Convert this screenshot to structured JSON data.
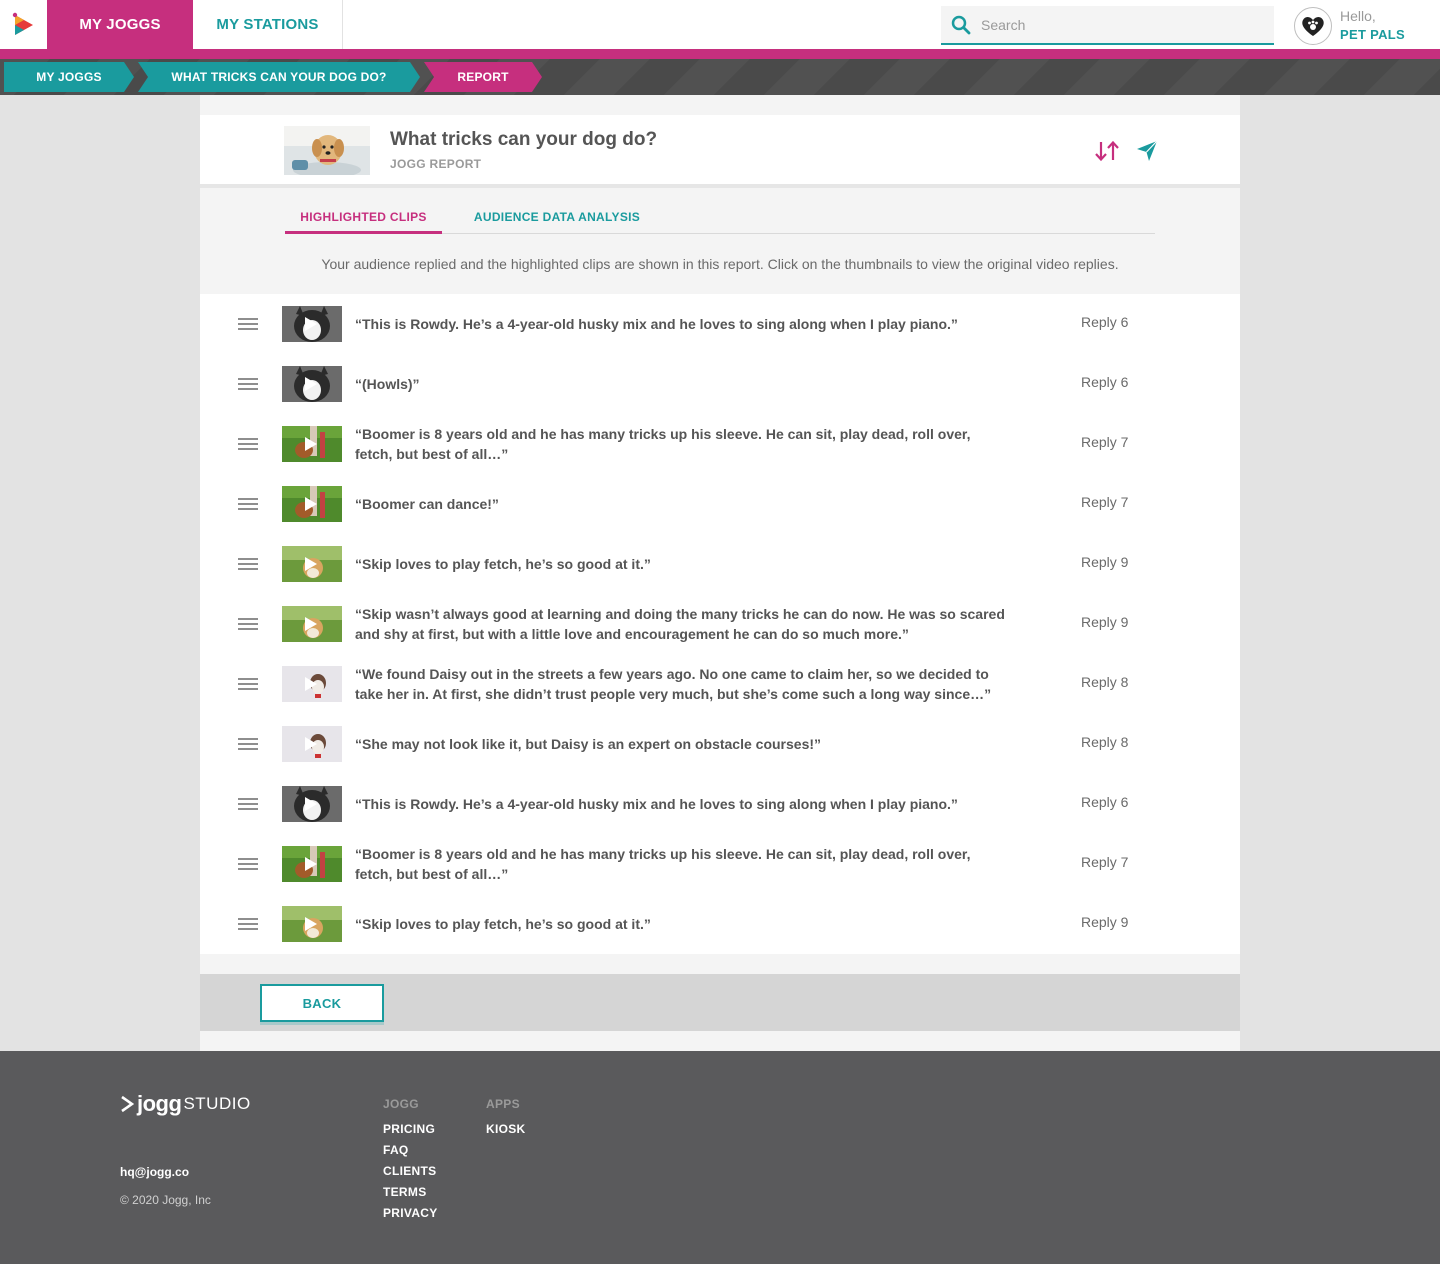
{
  "nav": {
    "tab_active": "MY JOGGS",
    "tab_other": "MY STATIONS",
    "search_placeholder": "Search",
    "greeting": "Hello,",
    "user_name": "PET PALS"
  },
  "breadcrumb": [
    "MY JOGGS",
    "WHAT TRICKS CAN YOUR DOG DO?",
    "REPORT"
  ],
  "report": {
    "title": "What tricks can your dog do?",
    "subtitle": "JOGG REPORT"
  },
  "tabs": [
    "HIGHLIGHTED CLIPS",
    "AUDIENCE DATA ANALYSIS"
  ],
  "intro": "Your audience replied and the highlighted clips are shown in this report. Click on the thumbnails to view the original video replies.",
  "clips": [
    {
      "quote": "“This is Rowdy. He’s a 4-year-old husky mix and he loves to sing along when I play piano.”",
      "reply": "Reply 6",
      "dog": "husky"
    },
    {
      "quote": "“(Howls)”",
      "reply": "Reply 6",
      "dog": "husky"
    },
    {
      "quote": "“Boomer is 8 years old and he has many tricks up his sleeve. He can sit, play dead, roll over, fetch, but best of all…”",
      "reply": "Reply 7",
      "dog": "boomer"
    },
    {
      "quote": "“Boomer can dance!”",
      "reply": "Reply 7",
      "dog": "boomer"
    },
    {
      "quote": "“Skip loves to play fetch, he’s so good at it.”",
      "reply": "Reply 9",
      "dog": "skip"
    },
    {
      "quote": "“Skip wasn’t always good at learning and doing the many tricks he can do now. He was so scared and shy at first, but with a little love and encouragement he can do so much more.”",
      "reply": "Reply 9",
      "dog": "skip"
    },
    {
      "quote": "“We found Daisy out in the streets a few years ago. No one came to claim her, so we decided to take her in. At first, she didn’t trust people very much, but she’s come such a long way since…”",
      "reply": "Reply 8",
      "dog": "daisy"
    },
    {
      "quote": "“She may not look like it, but Daisy is an expert on obstacle courses!”",
      "reply": "Reply 8",
      "dog": "daisy"
    },
    {
      "quote": "“This is Rowdy. He’s a 4-year-old husky mix and he loves to sing along when I play piano.”",
      "reply": "Reply 6",
      "dog": "husky"
    },
    {
      "quote": "“Boomer is 8 years old and he has many tricks up his sleeve. He can sit, play dead, roll over, fetch, but best of all…”",
      "reply": "Reply 7",
      "dog": "boomer"
    },
    {
      "quote": "“Skip loves to play fetch, he’s so good at it.”",
      "reply": "Reply 9",
      "dog": "skip"
    }
  ],
  "back_label": "BACK",
  "footer": {
    "brand": "jogg",
    "brand_suffix": "STUDIO",
    "email": "hq@jogg.co",
    "copyright": "© 2020 Jogg, Inc",
    "col1_heading": "JOGG",
    "col1_links": [
      "PRICING",
      "FAQ",
      "CLIENTS",
      "TERMS",
      "PRIVACY"
    ],
    "col2_heading": "APPS",
    "col2_links": [
      "KIOSK"
    ]
  },
  "colors": {
    "brand_pink": "#c62f7e",
    "brand_teal": "#1a9b9e",
    "footer_bg": "#5a5a5c"
  },
  "icons": [
    "search-icon",
    "sort-icon",
    "send-icon",
    "drag-handle-icon",
    "play-icon",
    "logo-icon",
    "heart-paw-icon"
  ]
}
